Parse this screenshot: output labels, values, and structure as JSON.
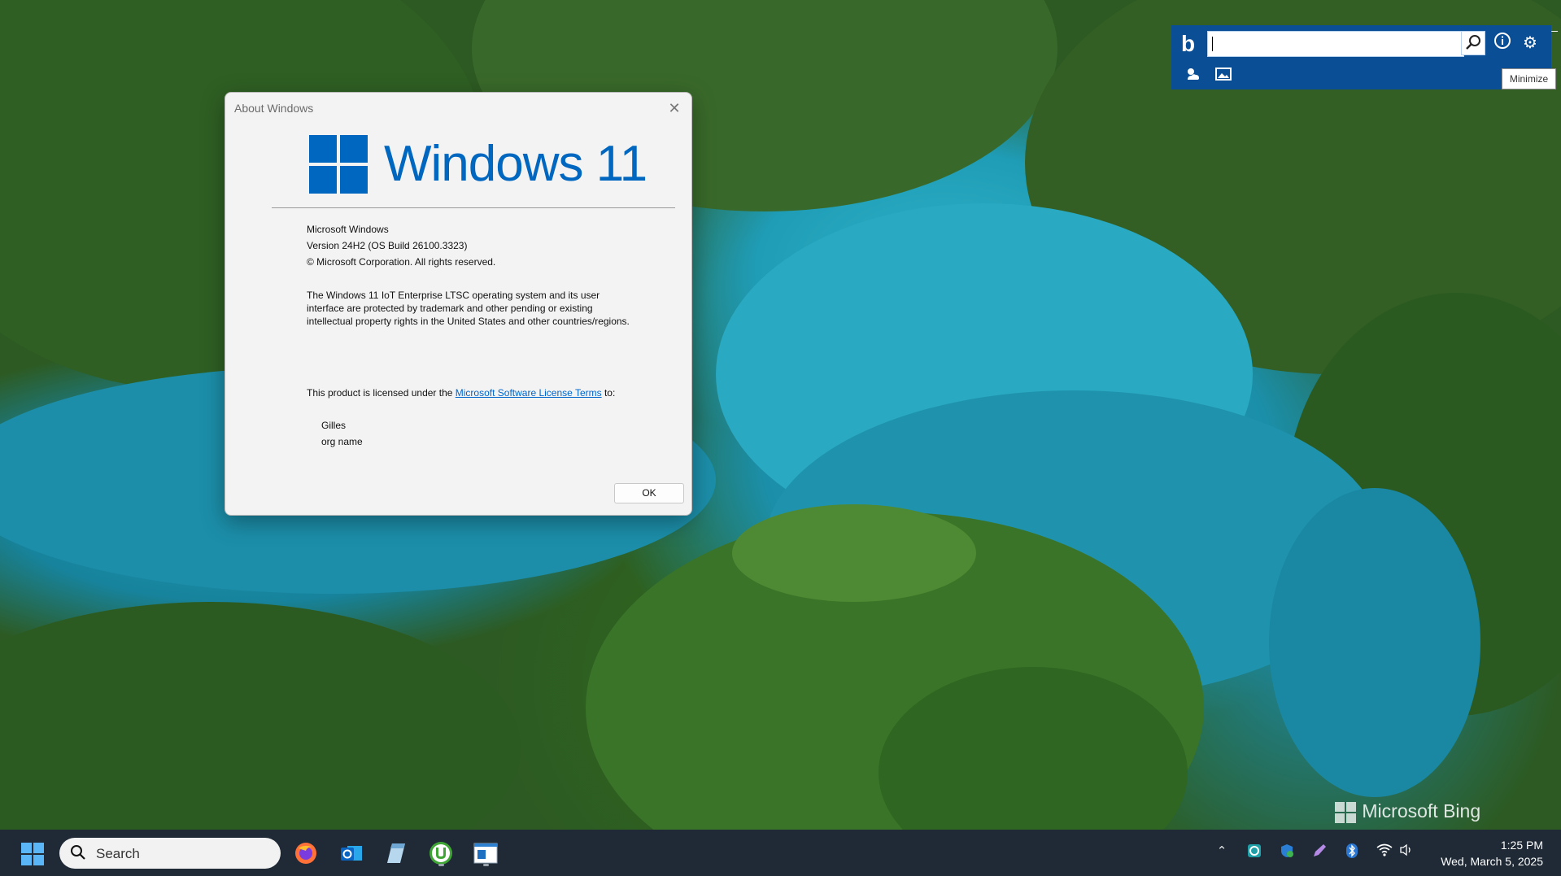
{
  "dialog": {
    "title": "About Windows",
    "brand": "Windows 11",
    "product": "Microsoft Windows",
    "version": "Version 24H2 (OS Build 26100.3323)",
    "copyright": "© Microsoft Corporation. All rights reserved.",
    "description": "The Windows 11 IoT Enterprise LTSC operating system and its user interface are protected by trademark and other pending or existing intellectual property rights in the United States and other countries/regions.",
    "license_prefix": "This product is licensed under the ",
    "license_link": "Microsoft Software License Terms",
    "license_suffix": " to:",
    "user_name": "Gilles",
    "org_name": "org name",
    "ok_label": "OK"
  },
  "bing_toolbar": {
    "search_value": "",
    "tooltip": "Minimize",
    "icons": [
      "bing-logo-icon",
      "search-icon",
      "info-icon",
      "settings-icon",
      "weather-icon",
      "image-icon"
    ]
  },
  "watermark": "Microsoft Bing",
  "taskbar": {
    "search_label": "Search",
    "apps": [
      "firefox-icon",
      "outlook-icon",
      "notepad-icon",
      "utorrent-icon",
      "app-window-icon"
    ],
    "tray": [
      "chevron-up-icon",
      "edge-icon",
      "defender-icon",
      "pen-icon",
      "bluetooth-icon",
      "wifi-icon",
      "volume-icon"
    ],
    "time": "1:25 PM",
    "date": "Wed, March 5, 2025"
  },
  "colors": {
    "accent": "#0067c0",
    "bing_bar": "#0a4e95",
    "taskbar": "#1f2a36"
  }
}
